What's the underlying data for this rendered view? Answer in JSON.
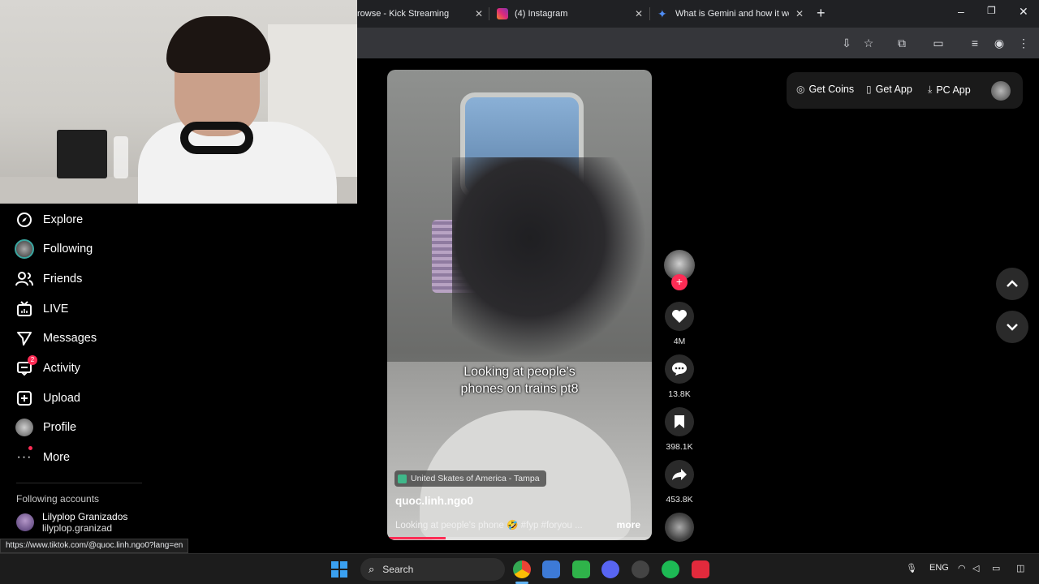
{
  "browser": {
    "tabs": [
      {
        "title": "rowse - Kick Streaming",
        "icon": "kick-icon",
        "color": "#53fc18"
      },
      {
        "title": "(4) Instagram",
        "icon": "instagram-icon",
        "color": "#e1306c"
      },
      {
        "title": "What is Gemini and how it works",
        "icon": "gemini-icon",
        "color": "#4f8df5"
      }
    ],
    "new_tab": "+",
    "status_url": "https://www.tiktok.com/@quoc.linh.ngo0?lang=en"
  },
  "sidebar": {
    "items": [
      {
        "label": "Explore",
        "icon": "compass-icon"
      },
      {
        "label": "Following",
        "icon": "following-avatar-icon"
      },
      {
        "label": "Friends",
        "icon": "friends-icon"
      },
      {
        "label": "LIVE",
        "icon": "live-icon"
      },
      {
        "label": "Messages",
        "icon": "messages-icon"
      },
      {
        "label": "Activity",
        "icon": "activity-icon",
        "badge": "2"
      },
      {
        "label": "Upload",
        "icon": "upload-icon"
      },
      {
        "label": "Profile",
        "icon": "profile-avatar-icon"
      },
      {
        "label": "More",
        "icon": "more-icon"
      }
    ],
    "following_title": "Following accounts",
    "following_accounts": [
      {
        "name": "Lilyplop Granizados",
        "username": "lilyplop.granizad"
      }
    ]
  },
  "video": {
    "caption_line1": "Looking at people’s",
    "caption_line2": "phones on trains pt8",
    "location": "United Skates of America - Tampa",
    "username": "quoc.linh.ngo0",
    "description": "Looking at people's phone 🤣 #fyp #foryou ...",
    "more": "more",
    "progress": 0.22
  },
  "actions": {
    "likes": "4M",
    "comments": "13.8K",
    "saves": "398.1K",
    "shares": "453.8K"
  },
  "topbar": {
    "get_coins": "Get Coins",
    "get_app": "Get App",
    "pc_app": "PC App"
  },
  "taskbar": {
    "search_placeholder": "Search",
    "language": "ENG"
  },
  "colors": {
    "brand": "#fe2c55",
    "accent_blue": "#3aa0f0"
  }
}
